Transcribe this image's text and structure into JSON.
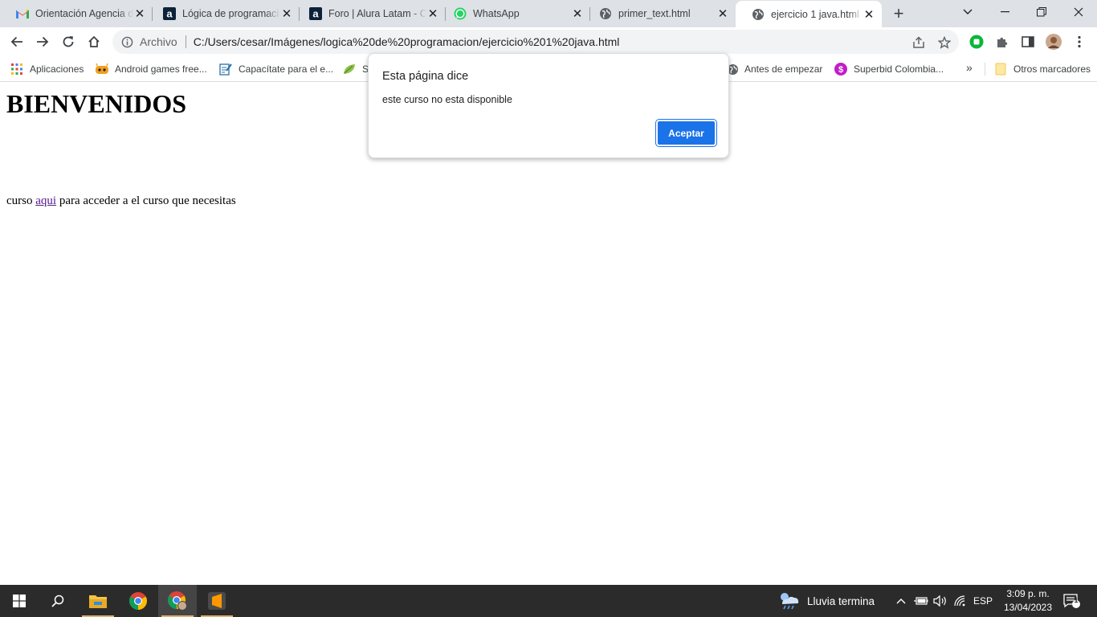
{
  "browser": {
    "tabs": [
      {
        "label": "Orientación Agencia de",
        "icon": "gmail-icon"
      },
      {
        "label": "Lógica de programación",
        "icon": "alura-icon"
      },
      {
        "label": "Foro | Alura Latam - Cursos",
        "icon": "alura-icon"
      },
      {
        "label": "WhatsApp",
        "icon": "whatsapp-icon"
      },
      {
        "label": "primer_text.html",
        "icon": "globe-icon"
      },
      {
        "label": "ejercicio 1 java.html",
        "icon": "globe-icon"
      }
    ],
    "active_tab": 5,
    "address": {
      "scheme": "Archivo",
      "url": "C:/Users/cesar/Imágenes/logica%20de%20programacion/ejercicio%201%20java.html"
    },
    "bookmarks": [
      {
        "label": "Aplicaciones",
        "icon": "apps-grid-icon"
      },
      {
        "label": "Android games free...",
        "icon": "android-games-icon"
      },
      {
        "label": "Capacítate para el e...",
        "icon": "capacitate-icon"
      },
      {
        "label": "S",
        "icon": "leaf-icon"
      },
      {
        "label": "Antes de empezar",
        "icon": "globe-icon"
      },
      {
        "label": "Superbid Colombia...",
        "icon": "superbid-icon"
      }
    ],
    "more_bookmarks": "»",
    "other_bookmarks": "Otros marcadores"
  },
  "page": {
    "heading": "BIENVENIDOS",
    "paragraph_before": "curso ",
    "link_text": "aqui",
    "paragraph_after": " para acceder a el curso que necesitas"
  },
  "dialog": {
    "title": "Esta página dice",
    "message": "este curso no esta disponible",
    "button": "Aceptar"
  },
  "taskbar": {
    "weather": "Lluvia termina",
    "language": "ESP",
    "time": "3:09 p. m.",
    "date": "13/04/2023",
    "notifications": "1"
  },
  "colors": {
    "accent": "#1a73e8",
    "tabstrip": "#dee1e6",
    "taskbar": "#2b2b2b",
    "visited_link": "#551a8b"
  }
}
